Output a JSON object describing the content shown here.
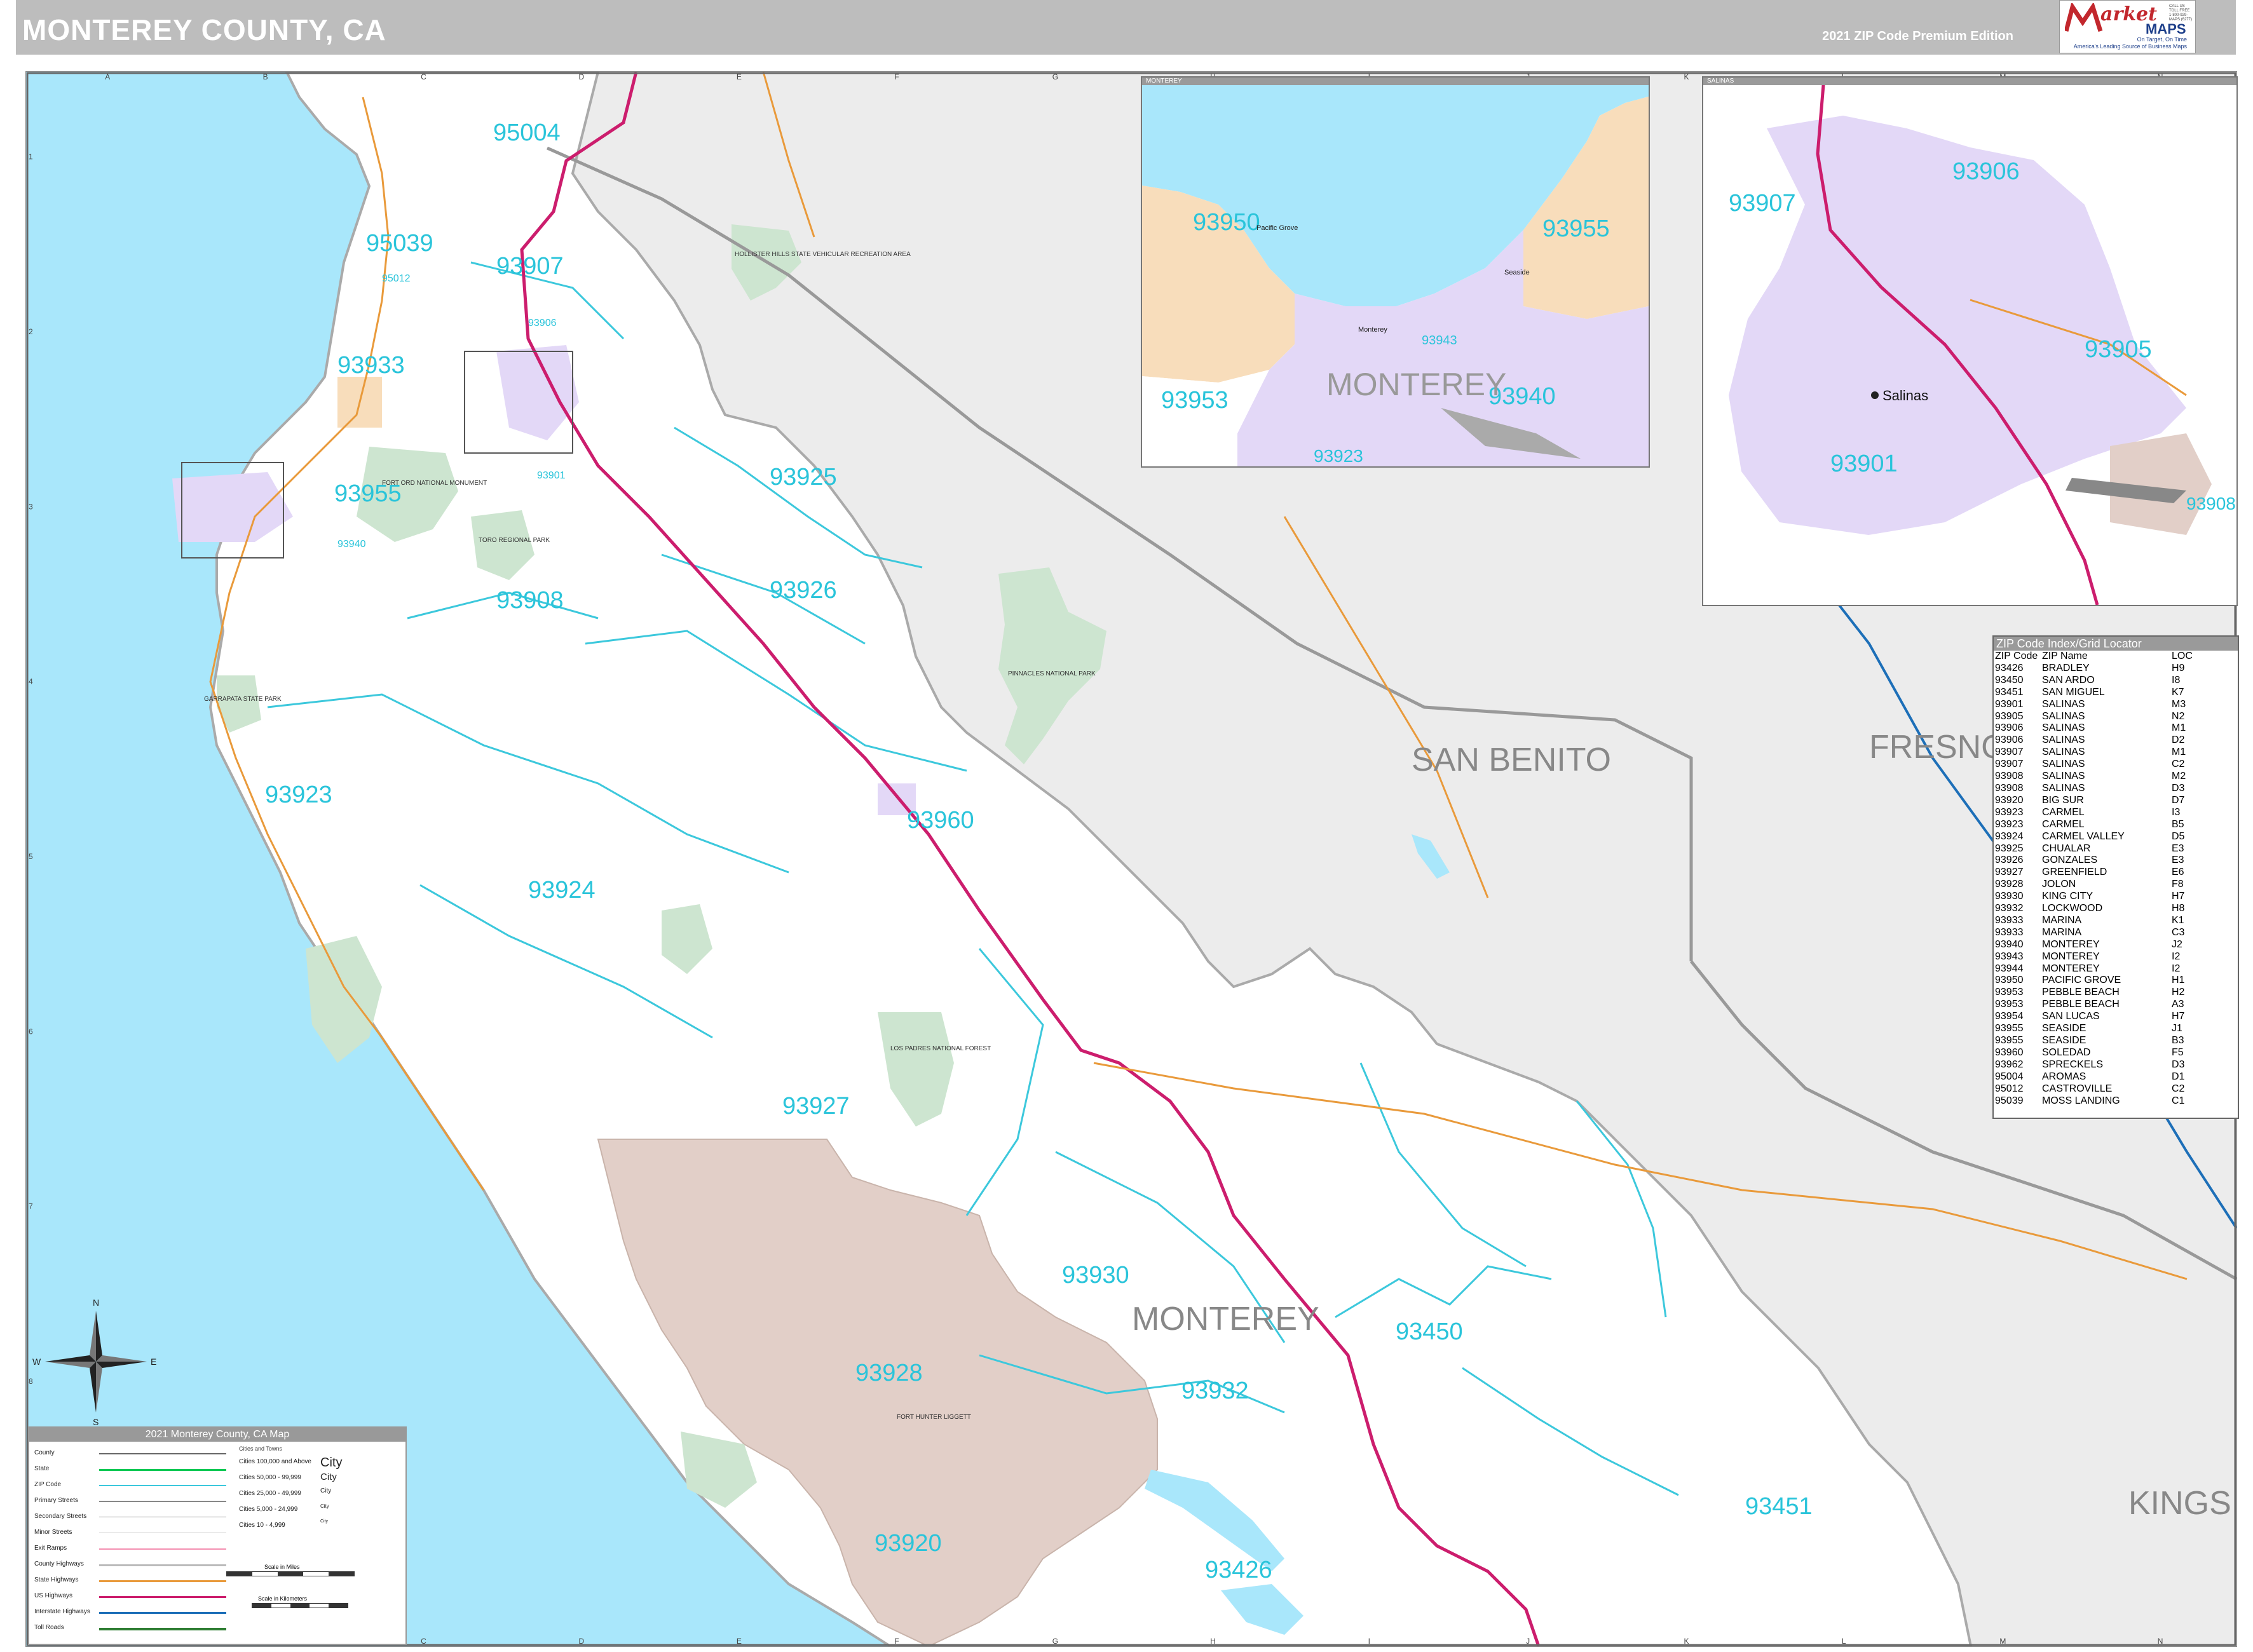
{
  "header": {
    "title": "MONTEREY COUNTY, CA",
    "edition": "2021 ZIP Code Premium Edition"
  },
  "logo": {
    "name_part1": "arket",
    "name_part2": "MAPS",
    "tagline": "On Target, On Time",
    "tagline2": "America's Leading Source of Business Maps",
    "contact": "CALL US TOLL FREE 1-800-929-MAPS (6277)"
  },
  "colors": {
    "ocean": "#a9e7fb",
    "outside_county": "#ececec",
    "national_forest": "#e2cfc8",
    "park": "#cde5d0",
    "city_purple": "#e3d8f7",
    "city_orange": "#f8ddbb",
    "zip_line": "#3cc8dc",
    "us_highway": "#cc1d6d",
    "state_highway": "#e99a3b",
    "interstate": "#1d6fb8",
    "zip_label": "#2ac4da",
    "county_label": "#888888"
  },
  "grid": {
    "columns": [
      "A",
      "B",
      "C",
      "D",
      "E",
      "F",
      "G",
      "H",
      "I",
      "J",
      "K",
      "L",
      "M",
      "N"
    ],
    "rows": [
      "1",
      "2",
      "3",
      "4",
      "5",
      "6",
      "7",
      "8",
      "9"
    ]
  },
  "county_labels": {
    "san_benito": "SAN BENITO",
    "fresno": "FRESNO",
    "monterey": "MONTEREY",
    "kings": "KINGS"
  },
  "zip_labels": [
    "95004",
    "95039",
    "93907",
    "93933",
    "93955",
    "93925",
    "93926",
    "93908",
    "93923",
    "93960",
    "93924",
    "93927",
    "93930",
    "93928",
    "93932",
    "93450",
    "93920",
    "93426",
    "93451"
  ],
  "small_zip_labels": [
    "95012",
    "93906",
    "93901",
    "93940"
  ],
  "inset_monterey": {
    "title": "MONTEREY",
    "zips": [
      "93950",
      "93955",
      "93953",
      "93940",
      "93923",
      "93943"
    ],
    "county_label": "MONTEREY",
    "places": [
      "Pacific Grove",
      "Seaside",
      "Monterey"
    ]
  },
  "inset_salinas": {
    "title": "SALINAS",
    "zips": [
      "93907",
      "93906",
      "93905",
      "93901",
      "93908"
    ],
    "places": [
      "Salinas"
    ]
  },
  "zip_index": {
    "title": "ZIP Code Index/Grid Locator",
    "headers": [
      "ZIP Code",
      "ZIP Name",
      "LOC"
    ],
    "rows": [
      [
        "93426",
        "BRADLEY",
        "H9"
      ],
      [
        "93450",
        "SAN ARDO",
        "I8"
      ],
      [
        "93451",
        "SAN MIGUEL",
        "K7"
      ],
      [
        "93901",
        "SALINAS",
        "M3"
      ],
      [
        "93905",
        "SALINAS",
        "N2"
      ],
      [
        "93906",
        "SALINAS",
        "M1"
      ],
      [
        "93906",
        "SALINAS",
        "D2"
      ],
      [
        "93907",
        "SALINAS",
        "M1"
      ],
      [
        "93907",
        "SALINAS",
        "C2"
      ],
      [
        "93908",
        "SALINAS",
        "M2"
      ],
      [
        "93908",
        "SALINAS",
        "D3"
      ],
      [
        "93920",
        "BIG SUR",
        "D7"
      ],
      [
        "93923",
        "CARMEL",
        "I3"
      ],
      [
        "93923",
        "CARMEL",
        "B5"
      ],
      [
        "93924",
        "CARMEL VALLEY",
        "D5"
      ],
      [
        "93925",
        "CHUALAR",
        "E3"
      ],
      [
        "93926",
        "GONZALES",
        "E3"
      ],
      [
        "93927",
        "GREENFIELD",
        "E6"
      ],
      [
        "93928",
        "JOLON",
        "F8"
      ],
      [
        "93930",
        "KING CITY",
        "H7"
      ],
      [
        "93932",
        "LOCKWOOD",
        "H8"
      ],
      [
        "93933",
        "MARINA",
        "K1"
      ],
      [
        "93933",
        "MARINA",
        "C3"
      ],
      [
        "93940",
        "MONTEREY",
        "J2"
      ],
      [
        "93943",
        "MONTEREY",
        "I2"
      ],
      [
        "93944",
        "MONTEREY",
        "I2"
      ],
      [
        "93950",
        "PACIFIC GROVE",
        "H1"
      ],
      [
        "93953",
        "PEBBLE BEACH",
        "H2"
      ],
      [
        "93953",
        "PEBBLE BEACH",
        "A3"
      ],
      [
        "93954",
        "SAN LUCAS",
        "H7"
      ],
      [
        "93955",
        "SEASIDE",
        "J1"
      ],
      [
        "93955",
        "SEASIDE",
        "B3"
      ],
      [
        "93960",
        "SOLEDAD",
        "F5"
      ],
      [
        "93962",
        "SPRECKELS",
        "D3"
      ],
      [
        "95004",
        "AROMAS",
        "D1"
      ],
      [
        "95012",
        "CASTROVILLE",
        "C2"
      ],
      [
        "95039",
        "MOSS LANDING",
        "C1"
      ]
    ]
  },
  "legend": {
    "title": "2021 Monterey County, CA Map",
    "items": [
      "County",
      "State",
      "ZIP Code",
      "Primary Streets",
      "Secondary Streets",
      "Minor Streets",
      "Exit Ramps",
      "County Highways",
      "State Highways",
      "US Highways",
      "Interstate Highways",
      "Toll Roads"
    ],
    "cities_header": "Cities and Towns",
    "city_sizes": [
      "Cities 100,000 and Above",
      "Cities 50,000 - 99,999",
      "Cities 25,000 - 49,999",
      "Cities 5,000 - 24,999",
      "Cities 10 - 4,999"
    ],
    "city_samples": [
      "City",
      "City",
      "City",
      "City",
      "City"
    ],
    "scale_miles": "Scale in Miles",
    "scale_km": "Scale in Kilometers"
  },
  "compass": {
    "n": "N",
    "s": "S",
    "e": "E",
    "w": "W"
  },
  "park_labels": [
    "PINNACLES NATIONAL PARK",
    "LOS PADRES NATIONAL FOREST",
    "FORT HUNTER LIGGETT",
    "FORT ORD NATIONAL MONUMENT",
    "HOLLISTER HILLS STATE VEHICULAR RECREATION AREA",
    "GARRAPATA STATE PARK",
    "TORO REGIONAL PARK"
  ]
}
